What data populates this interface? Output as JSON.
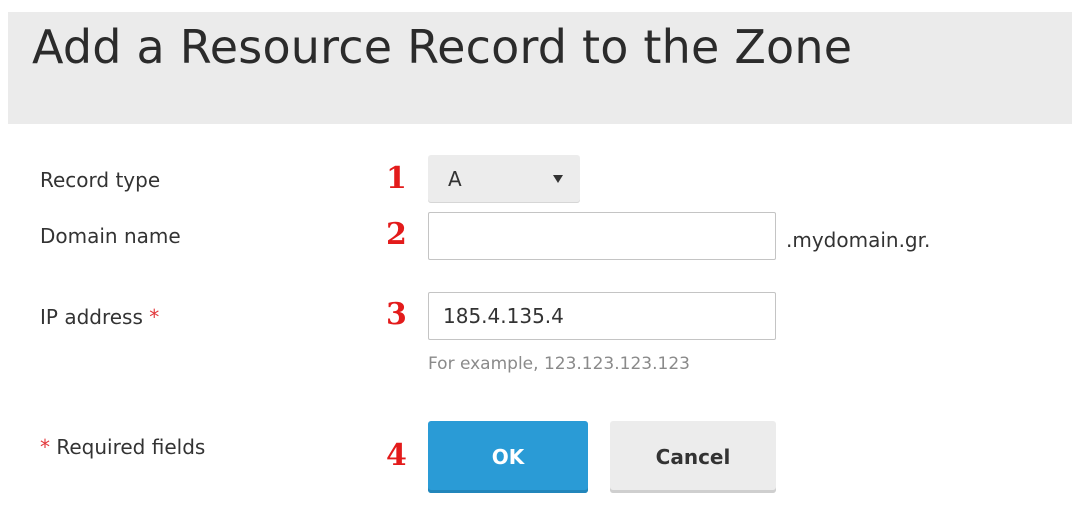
{
  "page": {
    "title": "Add a Resource Record to the Zone"
  },
  "form": {
    "record_type": {
      "label": "Record type",
      "value": "A",
      "marker": "1"
    },
    "domain_name": {
      "label": "Domain name",
      "value": "",
      "placeholder": "",
      "suffix": ".mydomain.gr.",
      "marker": "2"
    },
    "ip_address": {
      "label": "IP address",
      "required_mark": "*",
      "value": "185.4.135.4",
      "hint": "For example, 123.123.123.123",
      "marker": "3"
    },
    "footer": {
      "required_mark": "*",
      "required_note": " Required fields",
      "marker": "4"
    }
  },
  "buttons": {
    "ok_label": "OK",
    "cancel_label": "Cancel"
  },
  "icons": {
    "select_caret": "caret-down-icon"
  },
  "colors": {
    "primary_button": "#2a9bd6",
    "required": "#e2383c",
    "step_marker": "#e31b1b",
    "title_bar": "#ebebeb"
  }
}
